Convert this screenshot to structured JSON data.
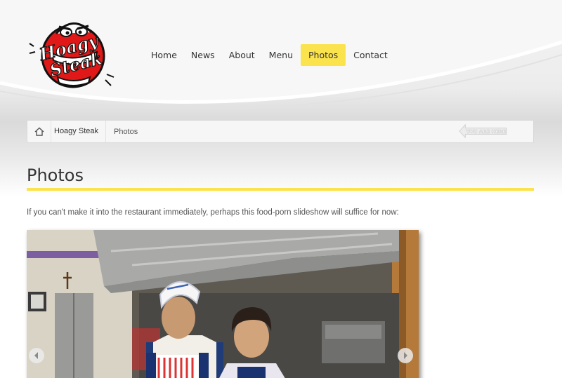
{
  "logo": {
    "line1": "Hoagy",
    "line2": "Steak"
  },
  "nav": {
    "items": [
      {
        "label": "Home"
      },
      {
        "label": "News"
      },
      {
        "label": "About"
      },
      {
        "label": "Menu"
      },
      {
        "label": "Photos",
        "active": true
      },
      {
        "label": "Contact"
      }
    ]
  },
  "breadcrumb": {
    "home_icon": "home-icon",
    "site": "Hoagy Steak",
    "current": "Photos",
    "you_are_here": "YOU ARE HERE"
  },
  "page": {
    "title": "Photos",
    "intro": "If you can't make it into the restaurant immediately, perhaps this food-porn slideshow will suffice for now:"
  },
  "slideshow": {
    "prev_icon": "arrow-left-icon",
    "next_icon": "arrow-right-icon"
  },
  "colors": {
    "accent": "#fbe34d",
    "logo_red": "#e01818"
  }
}
